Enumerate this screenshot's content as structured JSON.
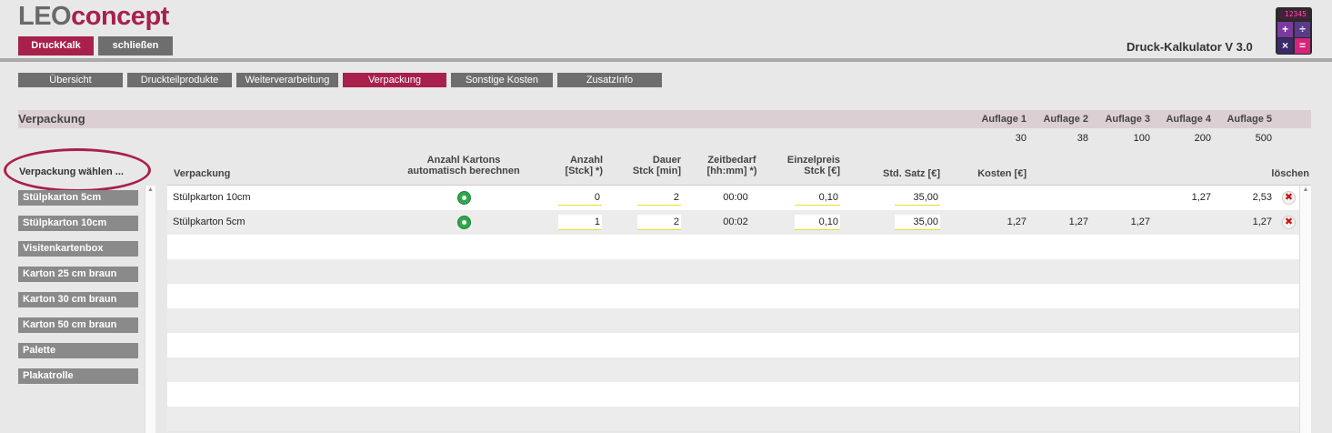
{
  "header": {
    "logo_leo": "LEO",
    "logo_concept": "concept",
    "btn_druckkalk": "DruckKalk",
    "btn_close": "schließen",
    "app_title": "Druck-Kalkulator V 3.0",
    "calc_display": "12345"
  },
  "tabs": [
    {
      "label": "Übersicht",
      "active": false
    },
    {
      "label": "Druckteilprodukte",
      "active": false
    },
    {
      "label": "Weiterverarbeitung",
      "active": false
    },
    {
      "label": "Verpackung",
      "active": true
    },
    {
      "label": "Sonstige Kosten",
      "active": false
    },
    {
      "label": "ZusatzInfo",
      "active": false
    }
  ],
  "section": {
    "title": "Verpackung",
    "auflagen": [
      {
        "label": "Auflage 1",
        "value": "30"
      },
      {
        "label": "Auflage 2",
        "value": "38"
      },
      {
        "label": "Auflage 3",
        "value": "100"
      },
      {
        "label": "Auflage 4",
        "value": "200"
      },
      {
        "label": "Auflage 5",
        "value": "500"
      }
    ]
  },
  "sidebar": {
    "choose_label": "Verpackung wählen ...",
    "items": [
      "Stülpkarton 5cm",
      "Stülpkarton 10cm",
      "Visitenkartenbox",
      "Karton 25 cm braun",
      "Karton 30 cm braun",
      "Karton 50 cm braun",
      "Palette",
      "Plakatrolle"
    ]
  },
  "table": {
    "headers": {
      "verpackung": "Verpackung",
      "auto_line1": "Anzahl Kartons",
      "auto_line2": "automatisch berechnen",
      "anzahl_line1": "Anzahl",
      "anzahl_line2": "[Stck] *)",
      "dauer_line1": "Dauer",
      "dauer_line2": "Stck [min]",
      "zeit_line1": "Zeitbedarf",
      "zeit_line2": "[hh:mm] *)",
      "einzel_line1": "Einzelpreis",
      "einzel_line2": "Stck [€]",
      "stdsatz": "Std. Satz [€]",
      "kosten": "Kosten [€]",
      "loeschen": "löschen"
    },
    "rows": [
      {
        "name": "Stülpkarton 10cm",
        "anzahl": "0",
        "dauer": "2",
        "zeit": "00:00",
        "einzelpreis": "0,10",
        "stdsatz": "35,00",
        "k1": "",
        "k2": "",
        "k3": "",
        "k4": "1,27",
        "k5": "2,53"
      },
      {
        "name": "Stülpkarton 5cm",
        "anzahl": "1",
        "dauer": "2",
        "zeit": "00:02",
        "einzelpreis": "0,10",
        "stdsatz": "35,00",
        "k1": "1,27",
        "k2": "1,27",
        "k3": "1,27",
        "k4": "",
        "k5": "1,27"
      }
    ],
    "delete_glyph": "✖",
    "scroll_up_glyph": "▲"
  },
  "colors": {
    "accent": "#a8214a",
    "button_gray": "#6e6e6e",
    "section_bar": "#dccfd3"
  }
}
